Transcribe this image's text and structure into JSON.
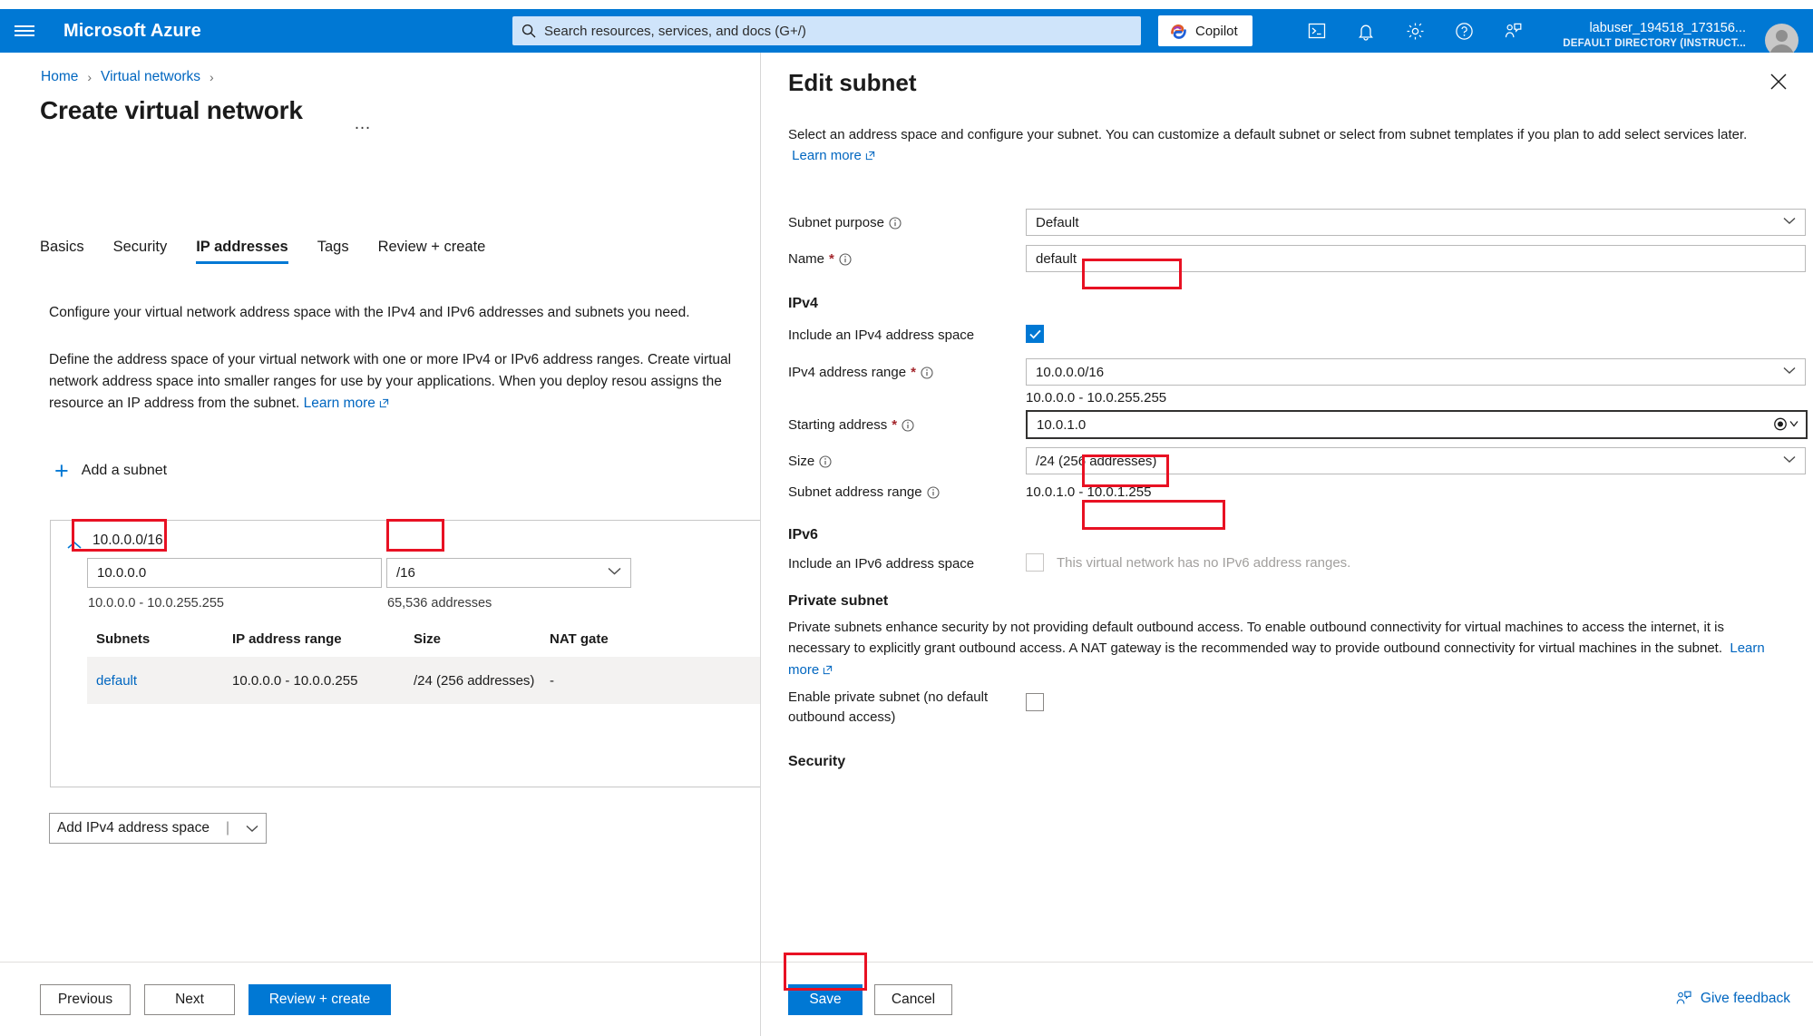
{
  "topbar": {
    "brand": "Microsoft Azure",
    "menu_icon": "hamburger-icon",
    "search": {
      "placeholder": "Search resources, services, and docs (G+/)",
      "value": "",
      "icon": "search-icon"
    },
    "copilot_label": "Copilot",
    "icons": [
      "cloud-shell-icon",
      "notifications-bell-icon",
      "settings-gear-icon",
      "help-question-icon",
      "feedback-icon"
    ],
    "account_name": "labuser_194518_173156...",
    "account_directory": "DEFAULT DIRECTORY (INSTRUCT..."
  },
  "left": {
    "breadcrumb": {
      "home": "Home",
      "virtual_networks": "Virtual networks"
    },
    "page_title": "Create virtual network",
    "more_actions": "…",
    "tabs": [
      {
        "label": "Basics",
        "active": false
      },
      {
        "label": "Security",
        "active": false
      },
      {
        "label": "IP addresses",
        "active": true
      },
      {
        "label": "Tags",
        "active": false
      },
      {
        "label": "Review + create",
        "active": false
      }
    ],
    "intro_1": "Configure your virtual network address space with the IPv4 and IPv6 addresses and subnets you need.",
    "intro_2": "Define the address space of your virtual network with one or more IPv4 or IPv6 address ranges. Create virtual network address space into smaller ranges for use by your applications. When you deploy resou assigns the resource an IP address from the subnet.",
    "learn_more": "Learn more",
    "add_subnet_label": "Add a subnet",
    "address_space": {
      "cidr_header": "10.0.0.0/16",
      "ip_value": "10.0.0.0",
      "mask_value": "/16",
      "range_note": "10.0.0.0 - 10.0.255.255",
      "count_note": "65,536 addresses"
    },
    "subnet_table": {
      "headers": [
        "Subnets",
        "IP address range",
        "Size",
        "NAT gate"
      ],
      "rows": [
        {
          "name": "default",
          "range": "10.0.0.0 - 10.0.0.255",
          "size": "/24 (256 addresses)",
          "nat": "-"
        }
      ]
    },
    "add_ipv4_button": "Add IPv4 address space",
    "footer": {
      "previous": "Previous",
      "next": "Next",
      "review_create": "Review + create"
    }
  },
  "blade": {
    "title": "Edit subnet",
    "close_icon": "close-icon",
    "description": "Select an address space and configure your subnet. You can customize a default subnet or select from subnet templates if you plan to add select services later.",
    "learn_more": "Learn more",
    "fields": {
      "subnet_purpose_label": "Subnet purpose",
      "subnet_purpose_value": "Default",
      "name_label": "Name",
      "name_value": "default",
      "ipv4_heading": "IPv4",
      "include_ipv4_label": "Include an IPv4 address space",
      "include_ipv4_checked": true,
      "ipv4_range_label": "IPv4 address range",
      "ipv4_range_value": "10.0.0.0/16",
      "ipv4_range_note": "10.0.0.0 - 10.0.255.255",
      "starting_address_label": "Starting address",
      "starting_address_value": "10.0.1.0",
      "size_label": "Size",
      "size_value": "/24 (256 addresses)",
      "subnet_address_range_label": "Subnet address range",
      "subnet_address_range_value": "10.0.1.0 - 10.0.1.255",
      "ipv6_heading": "IPv6",
      "include_ipv6_label": "Include an IPv6 address space",
      "include_ipv6_note": "This virtual network has no IPv6 address ranges.",
      "private_subnet_heading": "Private subnet",
      "private_subnet_desc": "Private subnets enhance security by not providing default outbound access. To enable outbound connectivity for virtual machines to access the internet, it is necessary to explicitly grant outbound access. A NAT gateway is the recommended way to provide outbound connectivity for virtual machines in the subnet.",
      "enable_private_subnet_label": "Enable private subnet (no default outbound access)",
      "security_heading": "Security"
    },
    "footer": {
      "save": "Save",
      "cancel": "Cancel",
      "give_feedback": "Give feedback"
    }
  },
  "annotations": {
    "color": "#e81123",
    "boxes": [
      "ip-value-box",
      "mask-value-box",
      "name-value-box",
      "starting-address-box",
      "size-value-box",
      "save-button-box"
    ]
  }
}
